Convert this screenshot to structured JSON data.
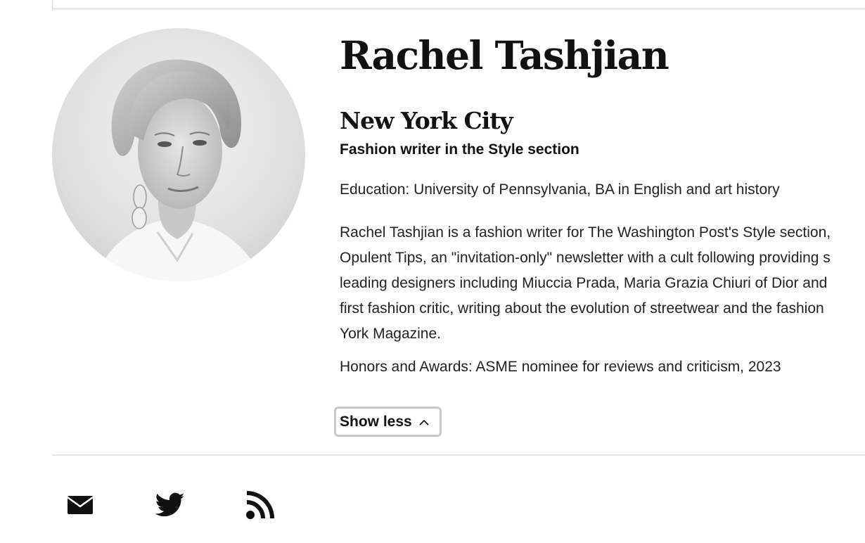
{
  "author": {
    "name": "Rachel Tashjian",
    "location": "New York City",
    "role": "Fashion writer in the Style section",
    "education": "Education: University of Pennsylvania, BA in English and art history",
    "bio_lines": [
      "Rachel Tashjian is a fashion writer for The Washington Post's Style section,",
      "Opulent Tips, an \"invitation-only\" newsletter with a cult following providing s",
      "leading designers including Miuccia Prada, Maria Grazia Chiuri of Dior and",
      "first fashion critic, writing about the evolution of streetwear and the fashion",
      "York Magazine."
    ],
    "honors": "Honors and Awards: ASME nominee for reviews and criticism, 2023",
    "photo_icon": "author-portrait"
  },
  "controls": {
    "show_less_label": "Show less",
    "show_less_icon": "chevron-up-icon"
  },
  "social": {
    "items": [
      {
        "icon": "email-icon"
      },
      {
        "icon": "twitter-icon"
      },
      {
        "icon": "rss-icon"
      }
    ]
  },
  "colors": {
    "text": "#111111",
    "divider": "#e6e6e6",
    "button_border": "#c8c8c8"
  }
}
